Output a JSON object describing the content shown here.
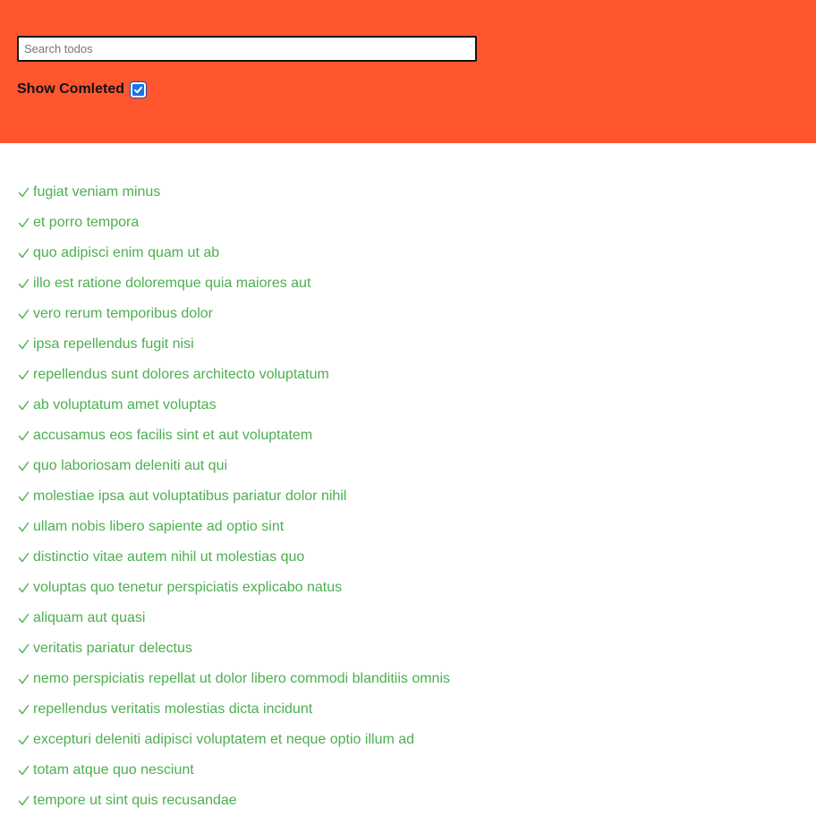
{
  "header": {
    "search_placeholder": "Search todos",
    "search_value": "",
    "show_completed_label": "Show Comleted",
    "show_completed_checked": true
  },
  "colors": {
    "header_bg": "#ff5630",
    "completed_text": "#4caf50",
    "checkbox_fill": "#1a73e8"
  },
  "todos": [
    {
      "text": "fugiat veniam minus",
      "completed": true
    },
    {
      "text": "et porro tempora",
      "completed": true
    },
    {
      "text": "quo adipisci enim quam ut ab",
      "completed": true
    },
    {
      "text": "illo est ratione doloremque quia maiores aut",
      "completed": true
    },
    {
      "text": "vero rerum temporibus dolor",
      "completed": true
    },
    {
      "text": "ipsa repellendus fugit nisi",
      "completed": true
    },
    {
      "text": "repellendus sunt dolores architecto voluptatum",
      "completed": true
    },
    {
      "text": "ab voluptatum amet voluptas",
      "completed": true
    },
    {
      "text": "accusamus eos facilis sint et aut voluptatem",
      "completed": true
    },
    {
      "text": "quo laboriosam deleniti aut qui",
      "completed": true
    },
    {
      "text": "molestiae ipsa aut voluptatibus pariatur dolor nihil",
      "completed": true
    },
    {
      "text": "ullam nobis libero sapiente ad optio sint",
      "completed": true
    },
    {
      "text": "distinctio vitae autem nihil ut molestias quo",
      "completed": true
    },
    {
      "text": "voluptas quo tenetur perspiciatis explicabo natus",
      "completed": true
    },
    {
      "text": "aliquam aut quasi",
      "completed": true
    },
    {
      "text": "veritatis pariatur delectus",
      "completed": true
    },
    {
      "text": "nemo perspiciatis repellat ut dolor libero commodi blanditiis omnis",
      "completed": true
    },
    {
      "text": "repellendus veritatis molestias dicta incidunt",
      "completed": true
    },
    {
      "text": "excepturi deleniti adipisci voluptatem et neque optio illum ad",
      "completed": true
    },
    {
      "text": "totam atque quo nesciunt",
      "completed": true
    },
    {
      "text": "tempore ut sint quis recusandae",
      "completed": true
    }
  ]
}
